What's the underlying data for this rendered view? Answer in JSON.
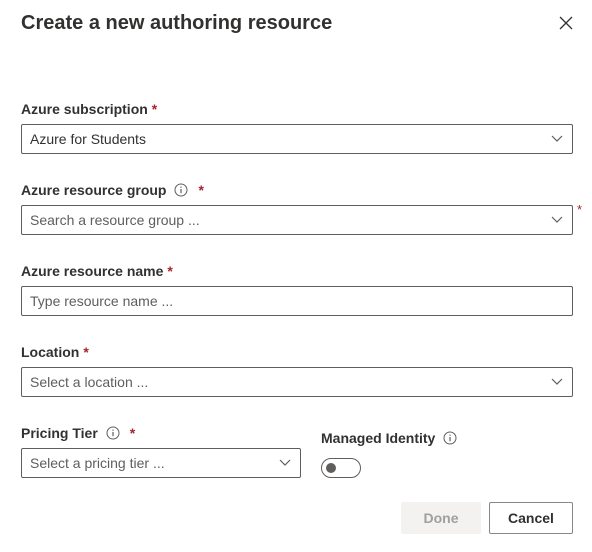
{
  "dialog": {
    "title": "Create a new authoring resource",
    "close_icon": "close-icon"
  },
  "fields": {
    "subscription": {
      "label": "Azure subscription",
      "required_mark": "*",
      "value": "Azure for Students"
    },
    "resource_group": {
      "label": "Azure resource group",
      "required_mark": "*",
      "side_required_mark": "*",
      "placeholder": "Search a resource group ..."
    },
    "resource_name": {
      "label": "Azure resource name",
      "required_mark": "*",
      "placeholder": "Type resource name ..."
    },
    "location": {
      "label": "Location",
      "required_mark": "*",
      "placeholder": "Select a location ..."
    },
    "pricing_tier": {
      "label": "Pricing Tier",
      "required_mark": "*",
      "placeholder": "Select a pricing tier ..."
    },
    "managed_identity": {
      "label": "Managed Identity",
      "checked": false
    }
  },
  "buttons": {
    "done": "Done",
    "cancel": "Cancel"
  },
  "colors": {
    "required": "#a4262c",
    "border": "#605e5c",
    "text": "#323130",
    "disabled_bg": "#f3f2f1",
    "disabled_text": "#a19f9d"
  }
}
